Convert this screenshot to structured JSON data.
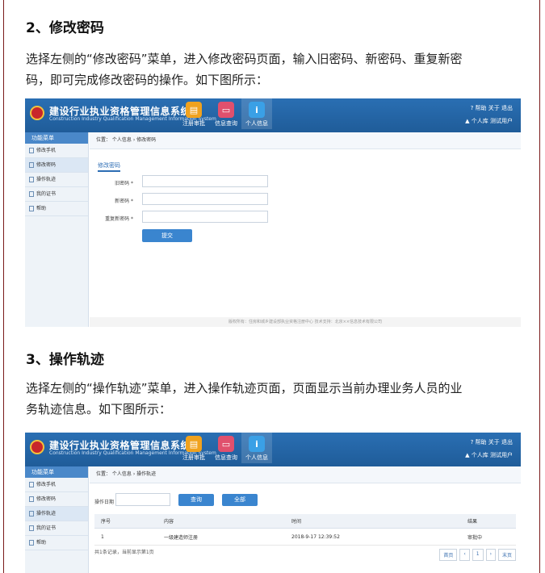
{
  "section2": {
    "heading": "2、修改密码",
    "para_line1": "选择左侧的“修改密码”菜单，进入修改密码页面，输入旧密码、新密码、重复新密",
    "para_line2": "码，即可完成修改密码的操作。如下图所示："
  },
  "section3": {
    "heading": "3、操作轨迹",
    "para_line1": "选择左侧的“操作轨迹”菜单，进入操作轨迹页面，页面显示当前办理业务人员的业",
    "para_line2": "务轨迹信息。如下图所示："
  },
  "app": {
    "system_title": "建设行业执业资格管理信息系统",
    "system_subtitle": "Construction Industry Qualification Management Information System",
    "nav": [
      "注册审批",
      "信息查询",
      "个人信息"
    ],
    "top_links": "? 帮助   关于   退出",
    "user": "▲ 个人库  测试用户",
    "sidebar_header": "功能菜单",
    "sidebar_items": [
      "修改手机",
      "修改密码",
      "操作轨迹",
      "我的证书",
      "帮助"
    ],
    "colors": {
      "header_blue": "#2a6fb3",
      "accent_blue": "#3a85cf"
    }
  },
  "shot1": {
    "breadcrumb": "位置：  个人信息  ›  修改密码",
    "tab": "修改密码",
    "fields": [
      "旧密码 *",
      "新密码 *",
      "重复新密码 *"
    ],
    "submit": "提交",
    "footer": "版权所有：住房和城乡建设部执业资格注册中心    技术支持：北京××信息技术有限公司"
  },
  "shot2": {
    "breadcrumb": "位置：  个人信息  ›  操作轨迹",
    "filter_label": "操作日期",
    "query_btn": "查询",
    "all_btn": "全部",
    "columns": [
      "序号",
      "内容",
      "时间",
      "结果"
    ],
    "rows": [
      [
        "1",
        "一级建造师注册",
        "2018-9-17 12:39:52",
        "审批中"
      ]
    ],
    "summary": "共1条记录，当前显示第1页",
    "pager": [
      "首页",
      "‹",
      "1",
      "›",
      "末页"
    ]
  }
}
